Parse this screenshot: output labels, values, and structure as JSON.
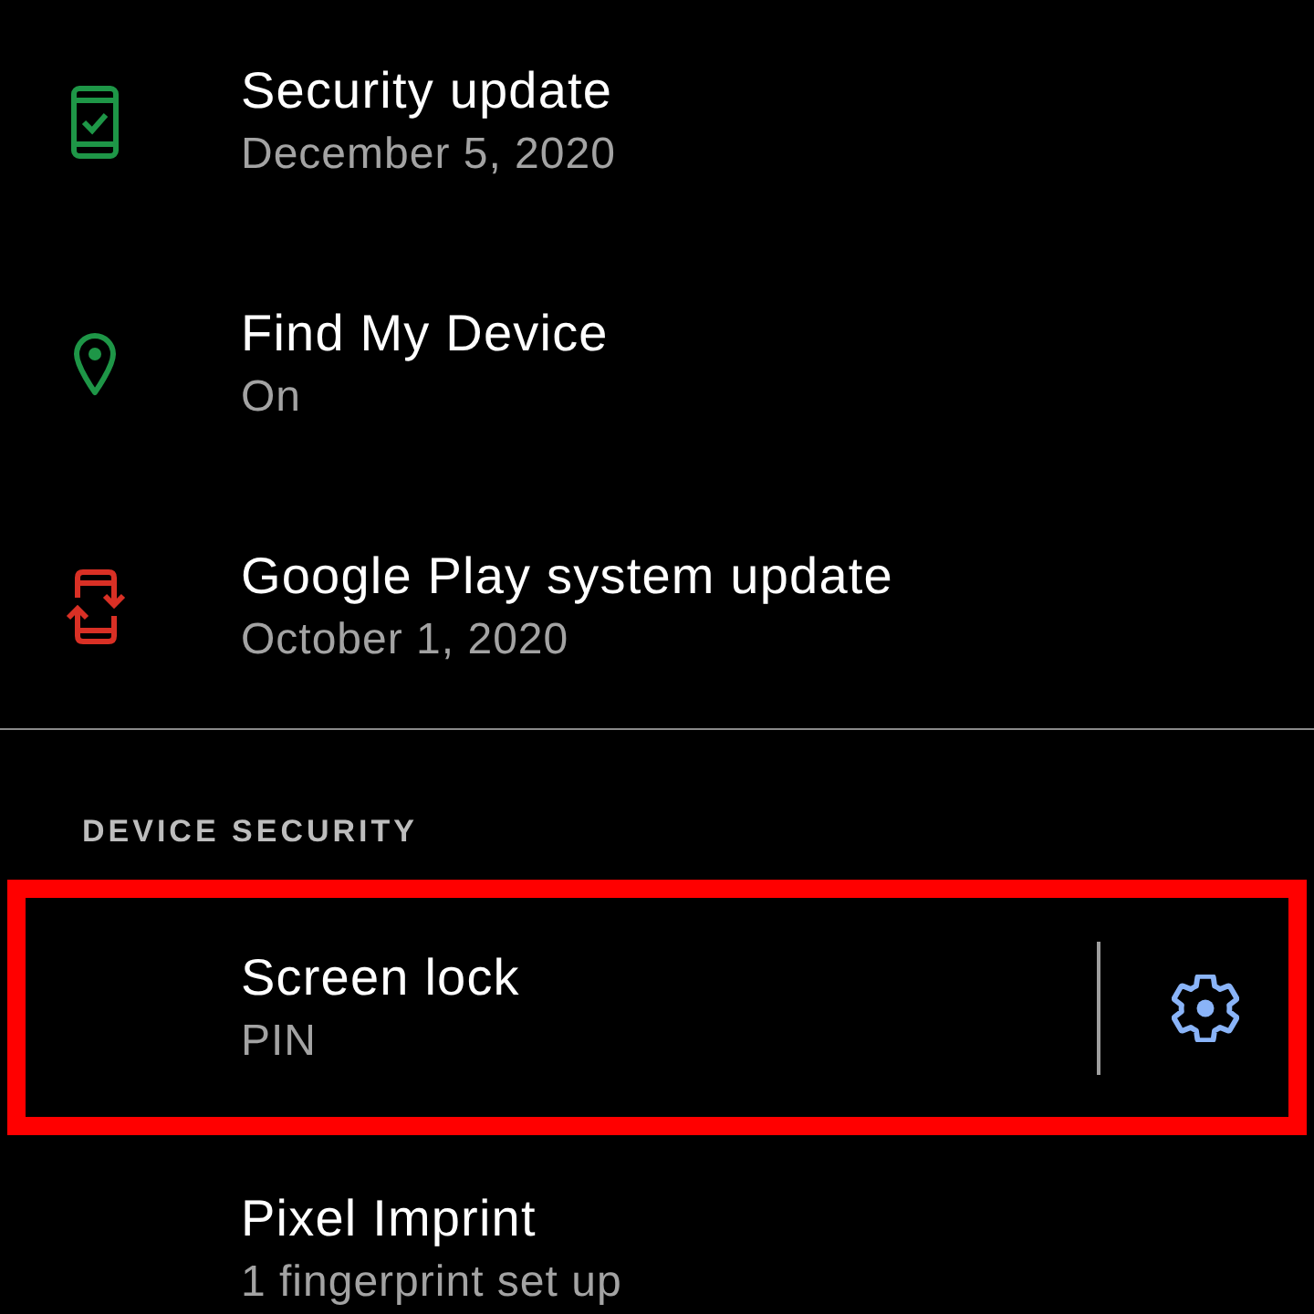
{
  "items": [
    {
      "kind": "icon",
      "title": "Security update",
      "subtitle": "December 5, 2020",
      "color": "#1e9647"
    },
    {
      "kind": "icon",
      "title": "Find My Device",
      "subtitle": "On",
      "color": "#1e9647"
    },
    {
      "kind": "icon",
      "title": "Google Play system update",
      "subtitle": "October 1, 2020",
      "color": "#d93025"
    }
  ],
  "device_security": {
    "heading": "DEVICE SECURITY",
    "items": [
      {
        "kind": "settings",
        "title": "Screen lock",
        "subtitle": "PIN",
        "highlighted": true
      },
      {
        "kind": "plain",
        "title": "Pixel Imprint",
        "subtitle": "1 fingerprint set up",
        "highlighted": false
      }
    ]
  }
}
